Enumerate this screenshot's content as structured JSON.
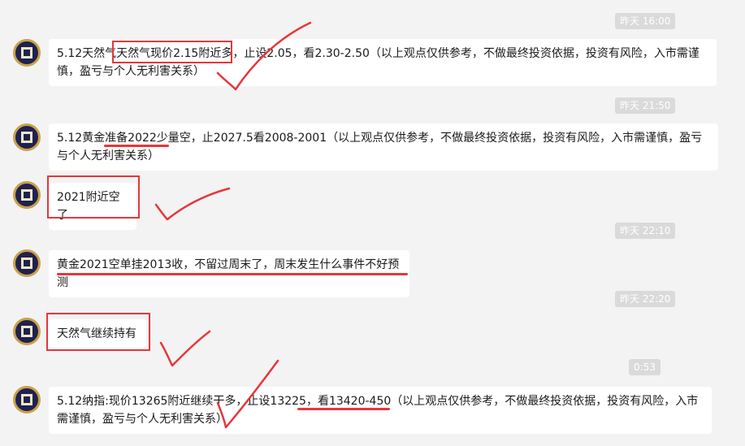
{
  "messages": [
    {
      "time": "昨天 16:00",
      "text": "5.12天然气天然气现价2.15附近多，止设2.05，看2.30-2.50（以上观点仅供参考，不做最终投资依据，投资有风险，入市需谨慎，盈亏与个人无利害关系）"
    },
    {
      "time": "昨天 21:50",
      "text": "5.12黄金准备2022少量空，止2027.5看2008-2001（以上观点仅供参考，不做最终投资依据，投资有风险，入市需谨慎，盈亏与个人无利害关系）"
    },
    {
      "time": "",
      "text": "2021附近空了"
    },
    {
      "time": "昨天 22:10",
      "text": "黄金2021空单挂2013收，不留过周末了，周末发生什么事件不好预测"
    },
    {
      "time": "昨天 22:20",
      "text": "天然气继续持有"
    },
    {
      "time": "0:53",
      "text": "5.12纳指:现价13265附近继续干多，止设13225，看13420-450（以上观点仅供参考，不做最终投资依据，投资有风险，入市需谨慎，盈亏与个人无利害关系）"
    }
  ],
  "colors": {
    "background": "#f3f3f3",
    "bubble": "#ffffff",
    "timestamp_bg": "#dadada",
    "annotation": "#e5373b",
    "avatar": "#1f2150",
    "avatar_ring": "#c9a24a"
  }
}
